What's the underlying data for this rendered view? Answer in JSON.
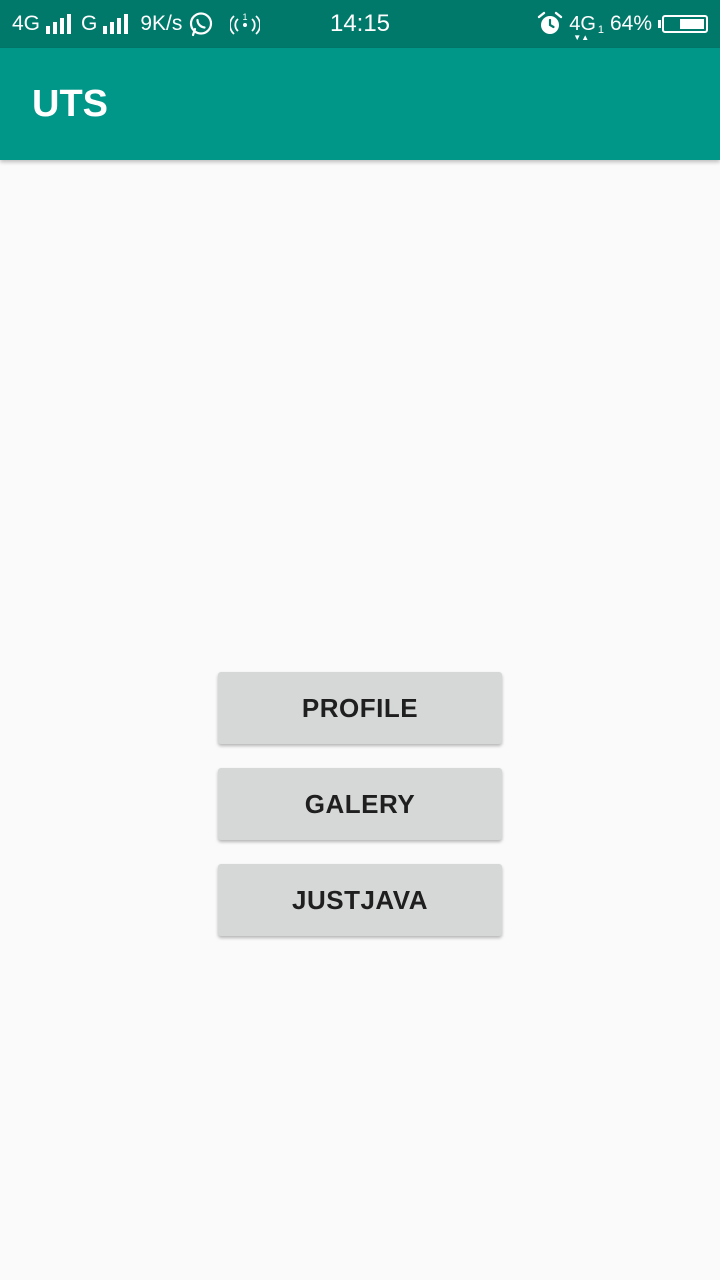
{
  "status_bar": {
    "network1": "4G",
    "network2": "G",
    "speed": "9K/s",
    "time": "14:15",
    "network3": "4G",
    "network3_sup": "1",
    "battery_text": "64%",
    "battery_level": 0.64,
    "icons": [
      "signal-icon",
      "whatsapp-icon",
      "hotspot-icon",
      "alarm-icon",
      "battery-icon"
    ]
  },
  "app_bar": {
    "title": "UTS",
    "color": "#009688",
    "status_color": "#00796b"
  },
  "buttons": {
    "profile": "PROFILE",
    "galery": "GALERY",
    "justjava": "JUSTJAVA"
  }
}
